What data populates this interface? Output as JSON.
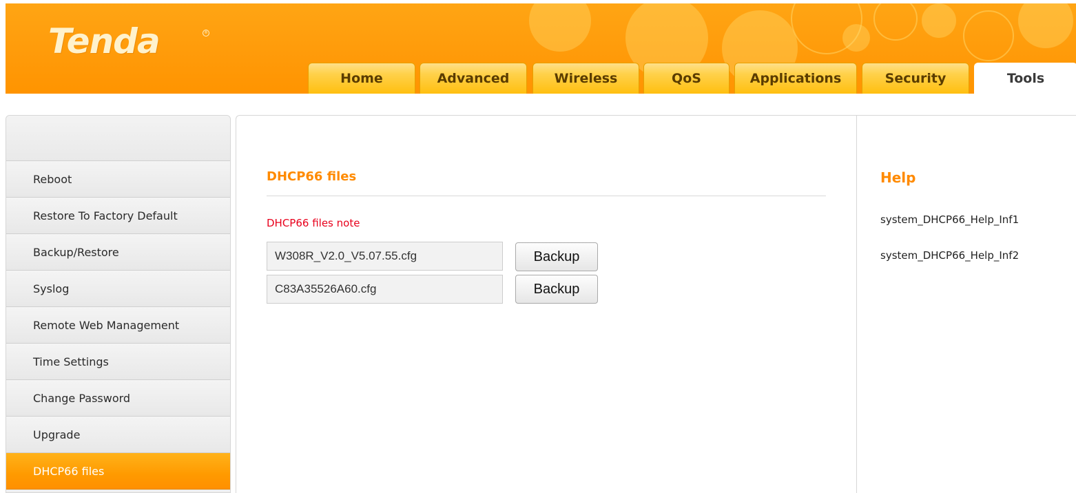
{
  "brand": {
    "logo_text": "Tenda",
    "registered_mark": "®"
  },
  "colors": {
    "accent": "#ff9400",
    "title": "#ff8a00",
    "note": "#e8001c",
    "active_tab_text": "#3a3a3a"
  },
  "nav": {
    "tabs": [
      {
        "label": "Home"
      },
      {
        "label": "Advanced"
      },
      {
        "label": "Wireless"
      },
      {
        "label": "QoS"
      },
      {
        "label": "Applications"
      },
      {
        "label": "Security"
      },
      {
        "label": "Tools"
      }
    ],
    "active_tab": "Tools"
  },
  "sidebar": {
    "items": [
      {
        "label": "Reboot"
      },
      {
        "label": "Restore To Factory Default"
      },
      {
        "label": "Backup/Restore"
      },
      {
        "label": "Syslog"
      },
      {
        "label": "Remote Web Management"
      },
      {
        "label": "Time Settings"
      },
      {
        "label": "Change Password"
      },
      {
        "label": "Upgrade"
      },
      {
        "label": "DHCP66 files"
      }
    ],
    "active_item": "DHCP66 files"
  },
  "main": {
    "title": "DHCP66 files",
    "note": "DHCP66 files note",
    "files": [
      {
        "name": "W308R_V2.0_V5.07.55.cfg",
        "button_label": "Backup"
      },
      {
        "name": "C83A35526A60.cfg",
        "button_label": "Backup"
      }
    ]
  },
  "help": {
    "title": "Help",
    "lines": [
      "system_DHCP66_Help_Inf1",
      "system_DHCP66_Help_Inf2"
    ]
  }
}
